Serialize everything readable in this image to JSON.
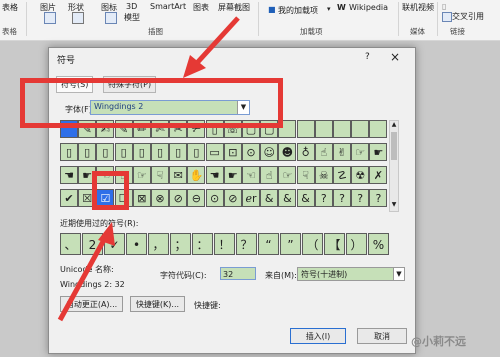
{
  "ribbon": {
    "items": [
      {
        "label": "表格",
        "group": "表格"
      },
      {
        "label": "图片"
      },
      {
        "label": "形状"
      },
      {
        "label": "图标"
      },
      {
        "label": "3D\n模型"
      },
      {
        "label": "SmartArt"
      },
      {
        "label": "图表"
      },
      {
        "label": "屏幕截图"
      }
    ],
    "illustrations_group": "插图",
    "my_addins": "我的加载项",
    "wikipedia": "Wikipedia",
    "addins_group": "加载项",
    "online_video": "联机视频",
    "media_group": "媒体",
    "crossref": "交叉引用",
    "links_group": "链接"
  },
  "dialog": {
    "title": "符号",
    "help": "?",
    "close": "×",
    "tab_symbols": "符号(S)",
    "tab_special": "特殊字符(P)",
    "font_label": "字体(F):",
    "font_value": "Wingdings 2",
    "grid_rows": [
      [
        "",
        "✎",
        "✍",
        "✎",
        "✏",
        "✄",
        "✂",
        "✃",
        "▯",
        "☏",
        "▢",
        "▢",
        "",
        "",
        "",
        "",
        "",
        ""
      ],
      [
        "▯",
        "▯",
        "▯",
        "▯",
        "▯",
        "▯",
        "▯",
        "▯",
        "▭",
        "⊡",
        "⊙",
        "☺",
        "☻",
        "♁",
        "☝",
        "✌",
        "☞",
        "☛"
      ],
      [
        "☚",
        "☛",
        "☜",
        "☝",
        "☞",
        "☟",
        "✉",
        "✋",
        "☚",
        "☛",
        "☜",
        "☝",
        "☞",
        "☟",
        "☠",
        "☡",
        "☢",
        "✗"
      ],
      [
        "✔",
        "☒",
        "☑",
        "☐",
        "⊠",
        "⊗",
        "⊘",
        "⊖",
        "⊙",
        "⊘",
        "ℯr",
        "&",
        "&",
        "&",
        "?",
        "?",
        "?",
        "?"
      ]
    ],
    "selected_index": {
      "row": 3,
      "col": 2
    },
    "recent_label": "近期使用过的符号(R):",
    "recent_symbols": [
      "、",
      "2",
      "✓",
      "•",
      "，",
      "；",
      "：",
      "！",
      "？",
      "“",
      "”",
      "（",
      "【",
      "）",
      "%"
    ],
    "unicode_name_label": "Unicode 名称:",
    "unicode_name_value": "Wingdings 2: 32",
    "charcode_label": "字符代码(C):",
    "charcode_value": "32",
    "from_label": "来自(M):",
    "from_value": "符号(十进制)",
    "autocorrect_button": "自动更正(A)...",
    "shortcut_button": "快捷键(K)...",
    "shortcut_label": "快捷键:",
    "insert_button": "插入(I)",
    "cancel_button": "取消"
  },
  "watermark": "@小莉不远",
  "colors": {
    "highlight": "#e53935",
    "cell_fill": "#c6e0b8",
    "selected_fill": "#2f6fe8"
  }
}
